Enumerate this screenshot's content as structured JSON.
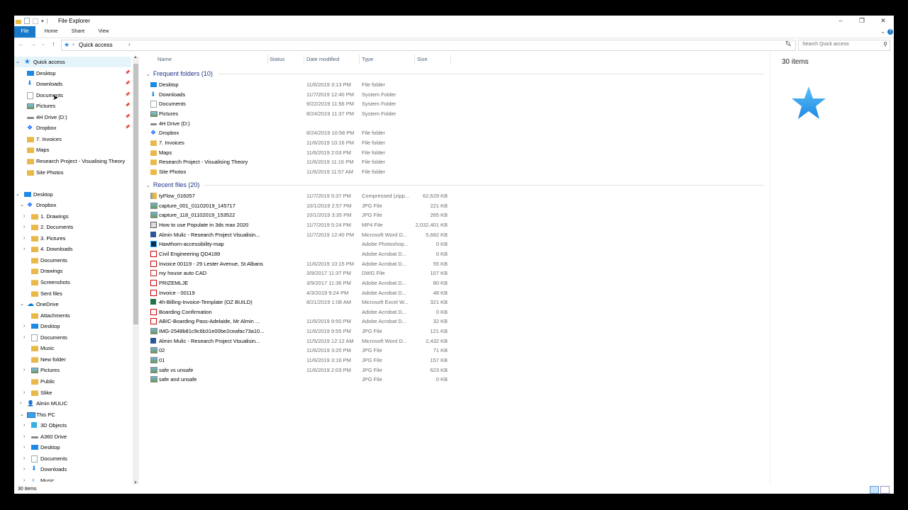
{
  "window": {
    "title": "File Explorer"
  },
  "ribbon": {
    "tabs": [
      "File",
      "Home",
      "Share",
      "View"
    ]
  },
  "address": {
    "crumb": "Quick access",
    "search_placeholder": "Search Quick access"
  },
  "icons": {
    "folder": "folder-icon",
    "desktop": "desktop-icon",
    "downloads": "download-arrow-icon",
    "documents": "documents-icon",
    "pictures": "pictures-icon",
    "drive": "drive-icon",
    "dropbox": "dropbox-icon",
    "onedrive": "cloud-icon",
    "pc": "computer-icon",
    "user": "user-icon",
    "cube": "3d-objects-icon",
    "music": "music-icon",
    "quick": "star-icon"
  },
  "colors": {
    "accent": "#1979ca",
    "group_header": "#1e3287",
    "selection": "#e5f3fb",
    "folder": "#e8b84a"
  },
  "nav": {
    "items": [
      {
        "label": "Quick access",
        "indent": 0,
        "arrow": "v",
        "icon": "quick",
        "sel": true
      },
      {
        "label": "Desktop",
        "indent": 1,
        "icon": "desktop",
        "pin": true
      },
      {
        "label": "Downloads",
        "indent": 1,
        "icon": "downloads",
        "pin": true
      },
      {
        "label": "Documents",
        "indent": 1,
        "icon": "documents",
        "pin": true
      },
      {
        "label": "Pictures",
        "indent": 1,
        "icon": "pictures",
        "pin": true,
        "hover": true
      },
      {
        "label": "4H Drive (D:)",
        "indent": 1,
        "icon": "drive",
        "pin": true
      },
      {
        "label": "Dropbox",
        "indent": 1,
        "icon": "dropbox",
        "pin": true
      },
      {
        "label": "7. Invoices",
        "indent": 1,
        "icon": "folder"
      },
      {
        "label": "Maps",
        "indent": 1,
        "icon": "folder"
      },
      {
        "label": "Research Project - Visualising Theory",
        "indent": 1,
        "icon": "folder"
      },
      {
        "label": "Site Photos",
        "indent": 1,
        "icon": "folder"
      },
      {
        "label": "",
        "indent": 0,
        "spacer": true
      },
      {
        "label": "Desktop",
        "indent": 0,
        "arrow": "v",
        "icon": "desktop"
      },
      {
        "label": "Dropbox",
        "indent": 1,
        "arrow": "v",
        "icon": "dropbox"
      },
      {
        "label": "1. Drawings",
        "indent": 2,
        "arrow": ">",
        "icon": "folder"
      },
      {
        "label": "2. Documents",
        "indent": 2,
        "arrow": ">",
        "icon": "folder"
      },
      {
        "label": "3. Pictures",
        "indent": 2,
        "arrow": ">",
        "icon": "folder"
      },
      {
        "label": "4. Downloads",
        "indent": 2,
        "arrow": ">",
        "icon": "folder"
      },
      {
        "label": "Documents",
        "indent": 2,
        "icon": "folder"
      },
      {
        "label": "Drawings",
        "indent": 2,
        "icon": "folder"
      },
      {
        "label": "Screenshots",
        "indent": 2,
        "icon": "folder"
      },
      {
        "label": "Sent files",
        "indent": 2,
        "icon": "folder"
      },
      {
        "label": "OneDrive",
        "indent": 1,
        "arrow": "v",
        "icon": "onedrive"
      },
      {
        "label": "Attachments",
        "indent": 2,
        "icon": "folder"
      },
      {
        "label": "Desktop",
        "indent": 2,
        "arrow": ">",
        "icon": "desktop"
      },
      {
        "label": "Documents",
        "indent": 2,
        "arrow": ">",
        "icon": "documents"
      },
      {
        "label": "Music",
        "indent": 2,
        "icon": "folder"
      },
      {
        "label": "New folder",
        "indent": 2,
        "icon": "folder"
      },
      {
        "label": "Pictures",
        "indent": 2,
        "arrow": ">",
        "icon": "pictures"
      },
      {
        "label": "Public",
        "indent": 2,
        "icon": "folder"
      },
      {
        "label": "Slike",
        "indent": 2,
        "arrow": ">",
        "icon": "folder"
      },
      {
        "label": "Almin MULIC",
        "indent": 1,
        "arrow": ">",
        "icon": "user"
      },
      {
        "label": "This PC",
        "indent": 1,
        "arrow": "v",
        "icon": "pc"
      },
      {
        "label": "3D Objects",
        "indent": 2,
        "arrow": ">",
        "icon": "cube"
      },
      {
        "label": "A360 Drive",
        "indent": 2,
        "arrow": ">",
        "icon": "drive"
      },
      {
        "label": "Desktop",
        "indent": 2,
        "arrow": ">",
        "icon": "desktop"
      },
      {
        "label": "Documents",
        "indent": 2,
        "arrow": ">",
        "icon": "documents"
      },
      {
        "label": "Downloads",
        "indent": 2,
        "arrow": ">",
        "icon": "downloads"
      },
      {
        "label": "Music",
        "indent": 2,
        "arrow": ">",
        "icon": "music"
      }
    ]
  },
  "columns": [
    "Name",
    "Status",
    "Date modified",
    "Type",
    "Size"
  ],
  "groups": {
    "frequent": {
      "title": "Frequent folders (10)",
      "rows": [
        {
          "name": "Desktop",
          "date": "11/6/2019 3:13 PM",
          "type": "File folder",
          "size": "",
          "icon": "desktop"
        },
        {
          "name": "Downloads",
          "date": "11/7/2019 12:40 PM",
          "type": "System Folder",
          "size": "",
          "icon": "downloads"
        },
        {
          "name": "Documents",
          "date": "9/22/2019 11:56 PM",
          "type": "System Folder",
          "size": "",
          "icon": "documents"
        },
        {
          "name": "Pictures",
          "date": "8/24/2019 11:37 PM",
          "type": "System Folder",
          "size": "",
          "icon": "pictures"
        },
        {
          "name": "4H Drive (D:)",
          "date": "",
          "type": "",
          "size": "",
          "icon": "drive"
        },
        {
          "name": "Dropbox",
          "date": "8/24/2019 10:58 PM",
          "type": "File folder",
          "size": "",
          "icon": "dropbox"
        },
        {
          "name": "7. Invoices",
          "date": "11/6/2019 10:16 PM",
          "type": "File folder",
          "size": "",
          "icon": "folder"
        },
        {
          "name": "Maps",
          "date": "11/6/2019 2:03 PM",
          "type": "File folder",
          "size": "",
          "icon": "folder"
        },
        {
          "name": "Research Project - Visualising Theory",
          "date": "11/6/2019 11:16 PM",
          "type": "File folder",
          "size": "",
          "icon": "folder"
        },
        {
          "name": "Site Photos",
          "date": "11/6/2019 11:57 AM",
          "type": "File folder",
          "size": "",
          "icon": "folder"
        }
      ]
    },
    "recent": {
      "title": "Recent files (20)",
      "rows": [
        {
          "name": "tyFlow_016057",
          "date": "11/7/2019 5:37 PM",
          "type": "Compressed (zipp...",
          "size": "62,629 KB",
          "icon": "zip"
        },
        {
          "name": "capture_001_01102019_145717",
          "date": "10/1/2019 2:57 PM",
          "type": "JPG File",
          "size": "221 KB",
          "icon": "jpg"
        },
        {
          "name": "capture_118_01102019_153522",
          "date": "10/1/2019 3:35 PM",
          "type": "JPG File",
          "size": "265 KB",
          "icon": "jpg"
        },
        {
          "name": "How to use Populate in 3ds max 2020",
          "date": "11/7/2019 5:24 PM",
          "type": "MP4 File",
          "size": "2,032,401 KB",
          "icon": "mp4"
        },
        {
          "name": "Almin Mulic - Research Project Visualisin...",
          "date": "11/7/2019 12:40 PM",
          "type": "Microsoft Word D...",
          "size": "5,682 KB",
          "icon": "word"
        },
        {
          "name": "Hawthorn-accessibility-map",
          "date": "",
          "type": "Adobe Photoshop...",
          "size": "0 KB",
          "icon": "psd"
        },
        {
          "name": "Civil Engineering QD4189",
          "date": "",
          "type": "Adobe Acrobat D...",
          "size": "0 KB",
          "icon": "pdf"
        },
        {
          "name": "Invoice 00119 - 29 Lester Avenue, St Albans",
          "date": "11/6/2019 10:15 PM",
          "type": "Adobe Acrobat D...",
          "size": "55 KB",
          "icon": "pdf"
        },
        {
          "name": "my house auto CAD",
          "date": "3/9/2017 11:37 PM",
          "type": "DWG File",
          "size": "107 KB",
          "icon": "dwg"
        },
        {
          "name": "PRIZEMLJE",
          "date": "3/9/2017 11:36 PM",
          "type": "Adobe Acrobat D...",
          "size": "80 KB",
          "icon": "pdf"
        },
        {
          "name": "Invoice - 00119",
          "date": "4/3/2019 9:24 PM",
          "type": "Adobe Acrobat D...",
          "size": "48 KB",
          "icon": "pdf"
        },
        {
          "name": "4h-Billing-Invoice-Template (OZ BUILD)",
          "date": "8/21/2019 1:08 AM",
          "type": "Microsoft Excel W...",
          "size": "321 KB",
          "icon": "excel"
        },
        {
          "name": "Boarding Confirmation",
          "date": "",
          "type": "Adobe Acrobat D...",
          "size": "0 KB",
          "icon": "pdf"
        },
        {
          "name": "ABIC-Boarding Pass-Adelaide, Mr Almin ...",
          "date": "11/6/2019 9:50 PM",
          "type": "Adobe Acrobat D...",
          "size": "32 KB",
          "icon": "pdf"
        },
        {
          "name": "IMG-2548b81c9c6b31e00be2ceafac73a10...",
          "date": "11/6/2019 9:55 PM",
          "type": "JPG File",
          "size": "121 KB",
          "icon": "jpg"
        },
        {
          "name": "Almin Mulic - Research Project Visualisin...",
          "date": "11/5/2019 12:12 AM",
          "type": "Microsoft Word D...",
          "size": "2,432 KB",
          "icon": "word"
        },
        {
          "name": "02",
          "date": "11/6/2019 3:20 PM",
          "type": "JPG File",
          "size": "71 KB",
          "icon": "jpg"
        },
        {
          "name": "01",
          "date": "11/6/2019 3:16 PM",
          "type": "JPG File",
          "size": "157 KB",
          "icon": "jpg"
        },
        {
          "name": "safe vs unsafe",
          "date": "11/6/2019 2:03 PM",
          "type": "JPG File",
          "size": "623 KB",
          "icon": "jpg"
        },
        {
          "name": "safe and unsafe",
          "date": "",
          "type": "JPG File",
          "size": "0 KB",
          "icon": "jpg"
        }
      ]
    }
  },
  "details": {
    "count": "30 items"
  },
  "status": {
    "count": "30 items"
  }
}
